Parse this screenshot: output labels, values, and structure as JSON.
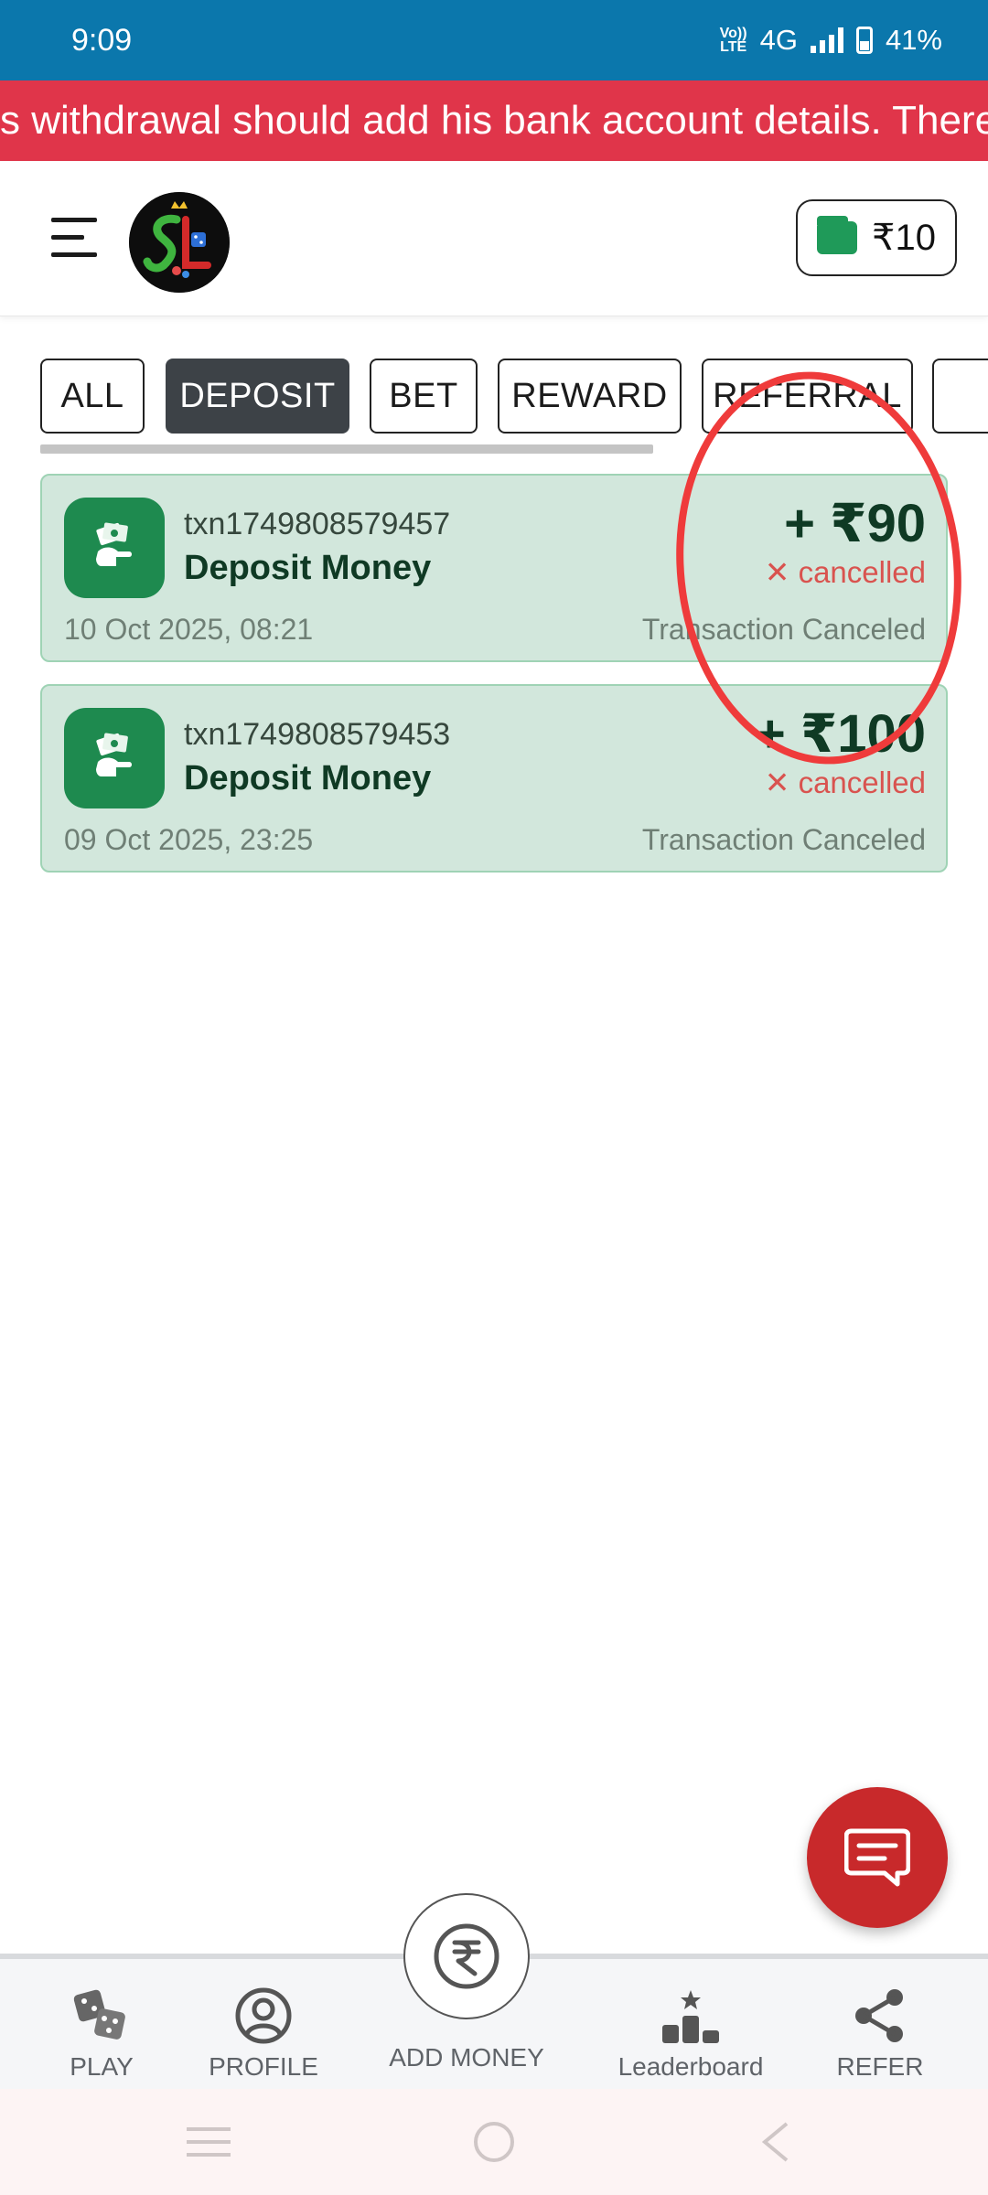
{
  "status_bar": {
    "time": "9:09",
    "volte": "Vo)) LTE",
    "network": "4G",
    "battery": "41%"
  },
  "marquee": {
    "text": "s withdrawal should add his bank account details. There"
  },
  "header": {
    "wallet_amount": "₹10"
  },
  "tabs": [
    {
      "label": "ALL",
      "active": false
    },
    {
      "label": "DEPOSIT",
      "active": true
    },
    {
      "label": "BET",
      "active": false
    },
    {
      "label": "REWARD",
      "active": false
    },
    {
      "label": "REFERRAL",
      "active": false
    }
  ],
  "transactions": [
    {
      "id": "txn1749808579457",
      "title": "Deposit Money",
      "amount": "+ ₹90",
      "status": "cancelled",
      "date": "10 Oct 2025, 08:21",
      "note": "Transaction Canceled"
    },
    {
      "id": "txn1749808579453",
      "title": "Deposit Money",
      "amount": "+ ₹100",
      "status": "cancelled",
      "date": "09 Oct 2025, 23:25",
      "note": "Transaction Canceled"
    }
  ],
  "bottom_nav": {
    "play": "PLAY",
    "profile": "PROFILE",
    "add_money": "ADD MONEY",
    "leaderboard": "Leaderboard",
    "refer": "REFER"
  },
  "icons": {
    "menu": "hamburger-icon",
    "wallet": "wallet-icon",
    "txn": "money-hand-icon",
    "chat": "chat-icon",
    "play": "dice-icon",
    "profile": "user-circle-icon",
    "add_money": "rupee-icon",
    "leaderboard": "podium-icon",
    "refer": "share-icon"
  },
  "colors": {
    "status_bar": "#0b77ac",
    "marquee": "#e0354a",
    "card_bg": "#d2e7dc",
    "card_border": "#9fd3b5",
    "accent_green": "#1e8a4f",
    "cancelled": "#d9534f",
    "fab": "#c8292b",
    "annotation": "#ef3b3b"
  }
}
